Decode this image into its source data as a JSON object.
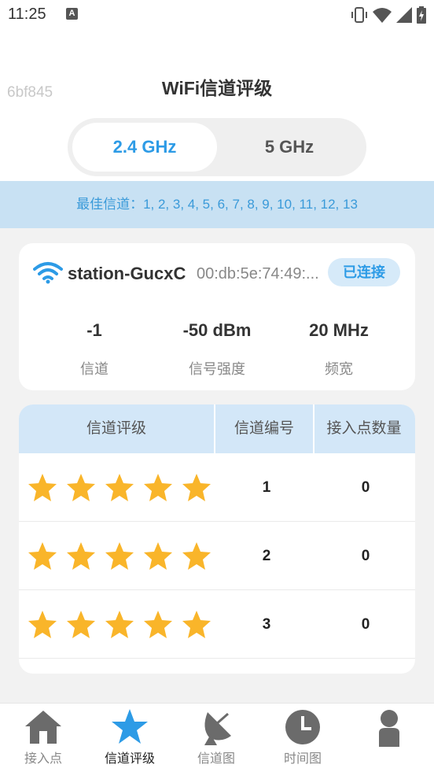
{
  "status_bar": {
    "time": "11:25",
    "notification_letter": "A"
  },
  "watermark": "6bf845",
  "page": {
    "title": "WiFi信道评级"
  },
  "bands": {
    "items": [
      {
        "label": "2.4 GHz",
        "active": true
      },
      {
        "label": "5 GHz",
        "active": false
      }
    ]
  },
  "best_channels": "最佳信道：1, 2, 3, 4, 5, 6, 7, 8, 9, 10, 11, 12, 13",
  "connection": {
    "ssid": "station-GucxC",
    "bssid": "00:db:5e:74:49:...",
    "status_badge": "已连接",
    "stats": [
      {
        "value": "-1",
        "label": "信道"
      },
      {
        "value": "-50 dBm",
        "label": "信号强度"
      },
      {
        "value": "20 MHz",
        "label": "频宽"
      }
    ]
  },
  "table": {
    "headers": [
      "信道评级",
      "信道编号",
      "接入点数量"
    ],
    "rows": [
      {
        "rating": 5,
        "channel": "1",
        "ap_count": "0"
      },
      {
        "rating": 5,
        "channel": "2",
        "ap_count": "0"
      },
      {
        "rating": 5,
        "channel": "3",
        "ap_count": "0"
      }
    ]
  },
  "bottom_nav": {
    "items": [
      {
        "label": "接入点",
        "icon": "home-icon",
        "active": false
      },
      {
        "label": "信道评级",
        "icon": "star-icon",
        "active": true
      },
      {
        "label": "信道图",
        "icon": "satellite-dish-icon",
        "active": false
      },
      {
        "label": "时间图",
        "icon": "clock-icon",
        "active": false
      },
      {
        "label": "",
        "icon": "person-icon",
        "active": false
      }
    ]
  },
  "colors": {
    "accent": "#2d9be6",
    "star": "#f9b52a",
    "best_bar_bg": "#c8e1f3",
    "table_header_bg": "#d3e7f8"
  }
}
